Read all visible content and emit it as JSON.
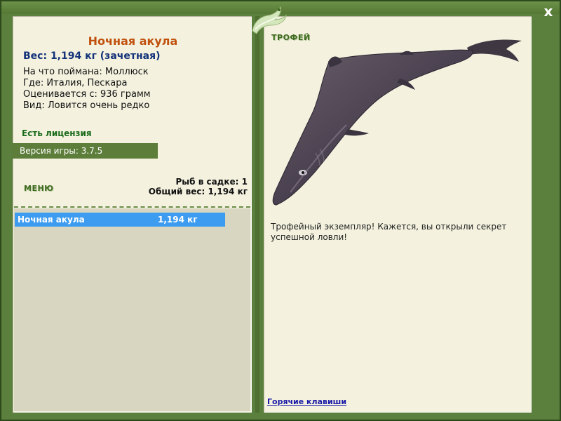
{
  "window": {
    "close_label": "x"
  },
  "fish": {
    "name": "Ночная акула",
    "weight_line": "Вес: 1,194 кг (зачетная)",
    "info": [
      "На что поймана: Моллюск",
      "Где: Италия, Пескара",
      "Оценивается с: 936 грамм",
      "Вид: Ловится очень редко"
    ]
  },
  "license": "Есть лицензия",
  "version": "Версия игры: 3.7.5",
  "menu": {
    "title": "МЕНЮ",
    "keepnet_count": "Рыб в садке: 1",
    "keepnet_weight": "Общий вес: 1,194 кг"
  },
  "list": [
    {
      "name": "Ночная акула",
      "weight": "1,194 кг"
    }
  ],
  "trophy": {
    "title": "ТРОФЕЙ",
    "description": "Трофейный экземпляр! Кажется, вы открыли секрет успешной ловли!"
  },
  "footer": {
    "hotkeys": "Горячие клавиши"
  },
  "colors": {
    "frame": "#5b7f3c",
    "panel": "#f4f2df",
    "title": "#c0500c",
    "weight": "#14327a",
    "highlight": "#3d9cf0"
  }
}
